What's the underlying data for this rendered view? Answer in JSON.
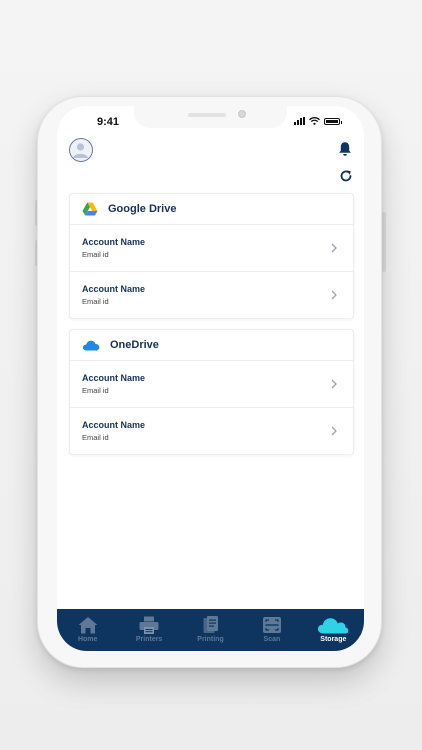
{
  "status_bar": {
    "time": "9:41"
  },
  "storage": {
    "providers": [
      {
        "name": "Google Drive",
        "icon": "google-drive-icon",
        "accounts": [
          {
            "name": "Account Name",
            "email": "Email id"
          },
          {
            "name": "Account Name",
            "email": "Email id"
          }
        ]
      },
      {
        "name": "OneDrive",
        "icon": "onedrive-icon",
        "accounts": [
          {
            "name": "Account Name",
            "email": "Email id"
          },
          {
            "name": "Account Name",
            "email": "Email id"
          }
        ]
      }
    ]
  },
  "tabbar": {
    "items": [
      {
        "label": "Home",
        "icon": "home-icon"
      },
      {
        "label": "Printers",
        "icon": "printer-icon"
      },
      {
        "label": "Printing",
        "icon": "printing-icon"
      },
      {
        "label": "Scan",
        "icon": "scan-icon"
      },
      {
        "label": "Storage",
        "icon": "cloud-icon"
      }
    ],
    "active": "Storage"
  },
  "colors": {
    "primary": "#16325c",
    "tabbar_bg": "#0d3560",
    "tab_inactive": "#5f7896",
    "active_accent": "#2fd3e8",
    "onedrive_blue": "#1e88e5"
  }
}
